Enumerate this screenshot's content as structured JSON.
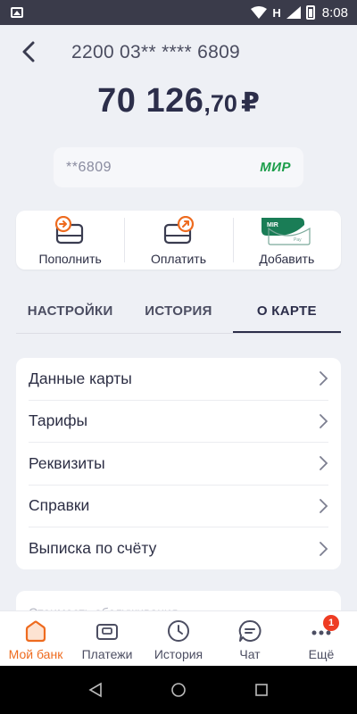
{
  "status_bar": {
    "network": "H",
    "time": "8:08"
  },
  "header": {
    "card_number": "2200 03** **** 6809"
  },
  "balance": {
    "integer": "70 126",
    "decimal": ",70",
    "currency": "₽"
  },
  "card_chip": {
    "masked_number": "**6809",
    "payment_system": "МИР"
  },
  "actions": [
    {
      "label": "Пополнить",
      "icon": "top-up-card-icon"
    },
    {
      "label": "Оплатить",
      "icon": "pay-card-icon"
    },
    {
      "label": "Добавить",
      "icon": "mir-pay-icon"
    }
  ],
  "mir_pay": {
    "brand": "MIR",
    "sub": "Pay"
  },
  "tabs": [
    {
      "label": "НАСТРОЙКИ",
      "active": false
    },
    {
      "label": "ИСТОРИЯ",
      "active": false
    },
    {
      "label": "О КАРТЕ",
      "active": true
    }
  ],
  "menu": [
    {
      "label": "Данные карты"
    },
    {
      "label": "Тарифы"
    },
    {
      "label": "Реквизиты"
    },
    {
      "label": "Справки"
    },
    {
      "label": "Выписка по счёту"
    }
  ],
  "peek": {
    "text": "Стоимость обслуживания"
  },
  "bottom_nav": [
    {
      "label": "Мой банк",
      "icon": "home-icon",
      "active": true
    },
    {
      "label": "Платежи",
      "icon": "wallet-icon",
      "active": false
    },
    {
      "label": "История",
      "icon": "clock-icon",
      "active": false
    },
    {
      "label": "Чат",
      "icon": "chat-icon",
      "active": false
    },
    {
      "label": "Ещё",
      "icon": "more-icon",
      "active": false,
      "badge": "1"
    }
  ],
  "colors": {
    "accent": "#ee6b1f",
    "text_dark": "#2c2e4a",
    "background": "#eef0f5",
    "badge": "#ee3c23",
    "mir_green": "#1c9e4a"
  }
}
